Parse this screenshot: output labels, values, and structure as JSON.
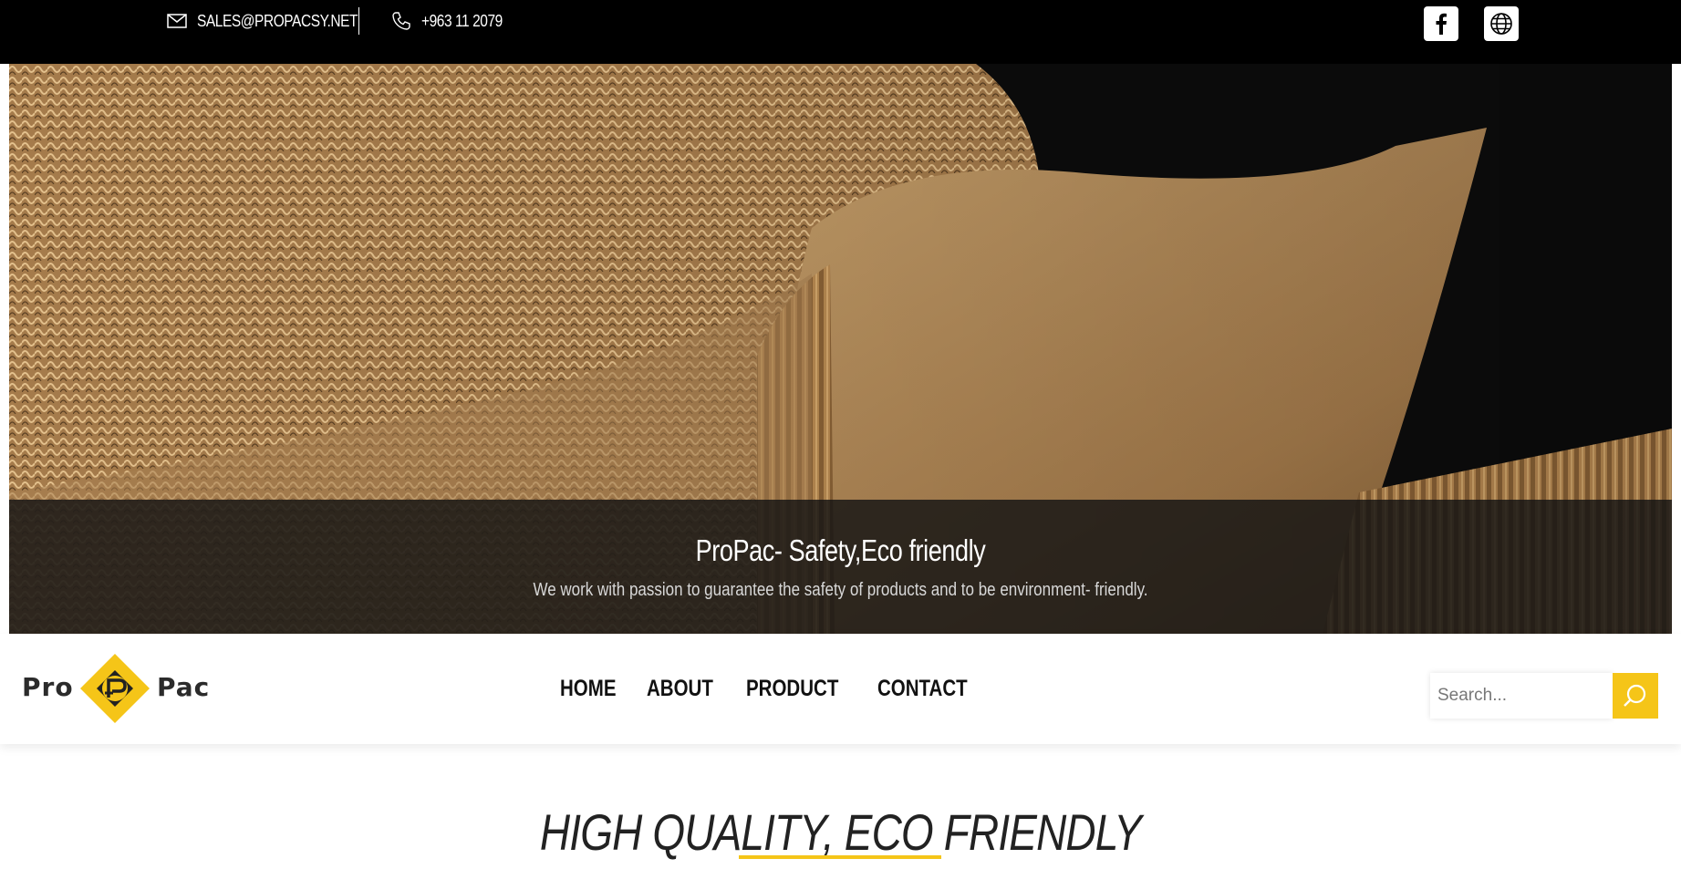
{
  "topbar": {
    "email": "SALES@PROPACSY.NET",
    "phone": "+963 11 2079",
    "icons": [
      "mail-icon",
      "phone-icon",
      "facebook-icon",
      "globe-icon"
    ]
  },
  "hero": {
    "title": "ProPac- Safety,Eco friendly",
    "subtitle": "We work with passion to guarantee the safety of products and to be environment- friendly."
  },
  "brand": {
    "left_word": "Pro",
    "right_word": "Pac",
    "accent_color": "#f5c518"
  },
  "nav": {
    "items": [
      {
        "label": "HOME"
      },
      {
        "label": "ABOUT"
      },
      {
        "label": "PRODUCT"
      },
      {
        "label": "CONTACT"
      }
    ]
  },
  "search": {
    "placeholder": "Search...",
    "icon": "search-icon"
  },
  "main": {
    "heading": "HIGH QUALITY, ECO FRIENDLY"
  }
}
